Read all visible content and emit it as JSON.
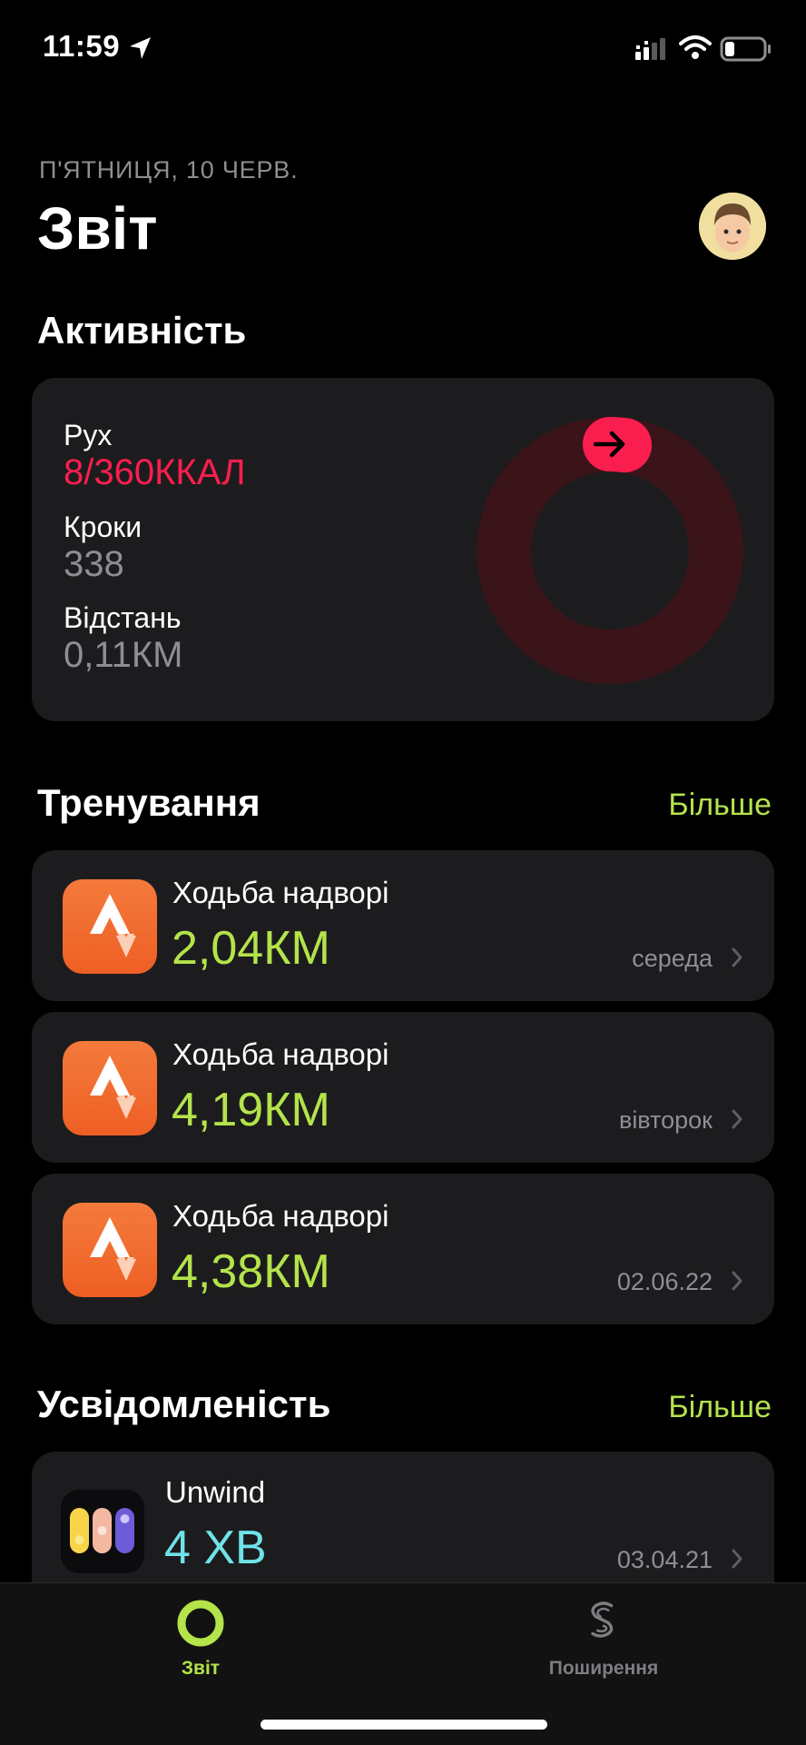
{
  "status_bar": {
    "time": "11:59",
    "icons": [
      "location-arrow-icon",
      "signal-icon",
      "wifi-icon",
      "battery-icon"
    ]
  },
  "header": {
    "date": "П'ЯТНИЦЯ, 10 ЧЕРВ.",
    "title": "Звіт",
    "avatar_icon": "memoji-avatar-icon"
  },
  "activity": {
    "section_title": "Активність",
    "move_label": "Рух",
    "move_value": "8/360ККАЛ",
    "steps_label": "Кроки",
    "steps_value": "338",
    "distance_label": "Відстань",
    "distance_value": "0,11КМ",
    "ring_progress": 0.022,
    "colors": {
      "move": "#fa1e4e",
      "ring_track": "#3a1419"
    }
  },
  "workouts": {
    "section_title": "Тренування",
    "more_label": "Більше",
    "items": [
      {
        "title": "Ходьба надворі",
        "value": "2,04КМ",
        "date": "середа",
        "icon": "strava-icon"
      },
      {
        "title": "Ходьба надворі",
        "value": "4,19КМ",
        "date": "вівторок",
        "icon": "strava-icon"
      },
      {
        "title": "Ходьба надворі",
        "value": "4,38КМ",
        "date": "02.06.22",
        "icon": "strava-icon"
      }
    ],
    "accent": "#b4e34a"
  },
  "mindfulness": {
    "section_title": "Усвідомленість",
    "more_label": "Більше",
    "item": {
      "title": "Unwind",
      "value": "4 ХВ",
      "date": "03.04.21",
      "icon": "unwind-app-icon"
    },
    "accent": "#6fe3e8"
  },
  "tab_bar": {
    "tabs": [
      {
        "label": "Звіт",
        "icon": "activity-ring-icon",
        "active": true
      },
      {
        "label": "Поширення",
        "icon": "sharing-icon",
        "active": false
      }
    ]
  }
}
